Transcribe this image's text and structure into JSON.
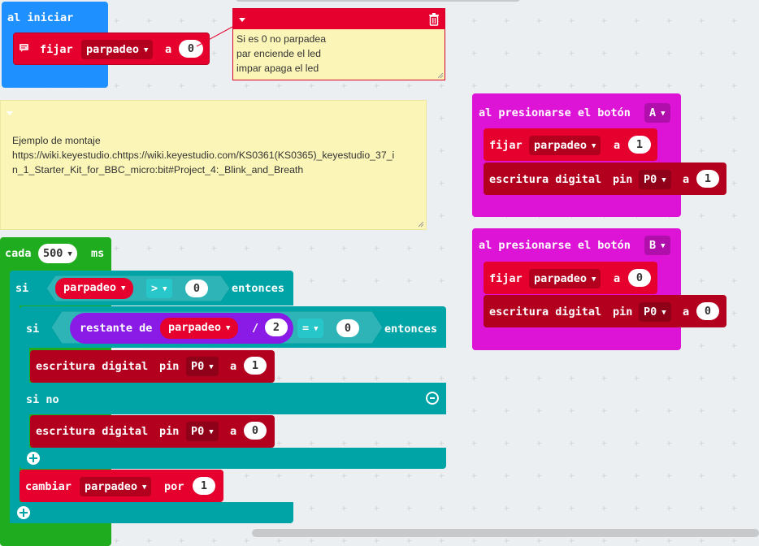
{
  "on_start": {
    "label": "al iniciar",
    "set_word": "fijar",
    "var": "parpadeo",
    "to_word": "a",
    "value": "0"
  },
  "comment_red": {
    "lines": [
      "Si es 0 no parpadea",
      "par enciende el led",
      "impar apaga el led"
    ]
  },
  "comment_yellow": {
    "title": "Ejemplo de montaje",
    "line1": "https://wiki.keyestudio.chttps://wiki.keyestudio.com/KS0361(KS0365)_keyestudio_37_i",
    "line2": "n_1_Starter_Kit_for_BBC_micro:bit#Project_4:_Blink_and_Breath"
  },
  "button_a": {
    "label": "al presionarse el botón",
    "button": "A",
    "set_word": "fijar",
    "var": "parpadeo",
    "to_word": "a",
    "value": "1",
    "write_label": "escritura digital",
    "pin_word": "pin",
    "pin": "P0",
    "write_value": "1"
  },
  "button_b": {
    "label": "al presionarse el botón",
    "button": "B",
    "set_word": "fijar",
    "var": "parpadeo",
    "to_word": "a",
    "value": "0",
    "write_label": "escritura digital",
    "pin_word": "pin",
    "pin": "P0",
    "write_value": "0"
  },
  "forever": {
    "every_word": "cada",
    "interval": "500",
    "unit": "ms",
    "if_word": "si",
    "var": "parpadeo",
    "op_gt": ">",
    "gt_value": "0",
    "then_word": "entonces",
    "inner_if_word": "si",
    "remainder_word": "restante de",
    "remainder_var": "parpadeo",
    "div_op": "/",
    "divisor": "2",
    "op_eq": "=",
    "eq_value": "0",
    "inner_then_word": "entonces",
    "write1_label": "escritura digital",
    "write1_pin_word": "pin",
    "write1_pin": "P0",
    "write1_to": "a",
    "write1_value": "1",
    "else_word": "si no",
    "write2_label": "escritura digital",
    "write2_pin_word": "pin",
    "write2_pin": "P0",
    "write2_to": "a",
    "write2_value": "0",
    "change_word": "cambiar",
    "change_var": "parpadeo",
    "by_word": "por",
    "change_value": "1"
  }
}
